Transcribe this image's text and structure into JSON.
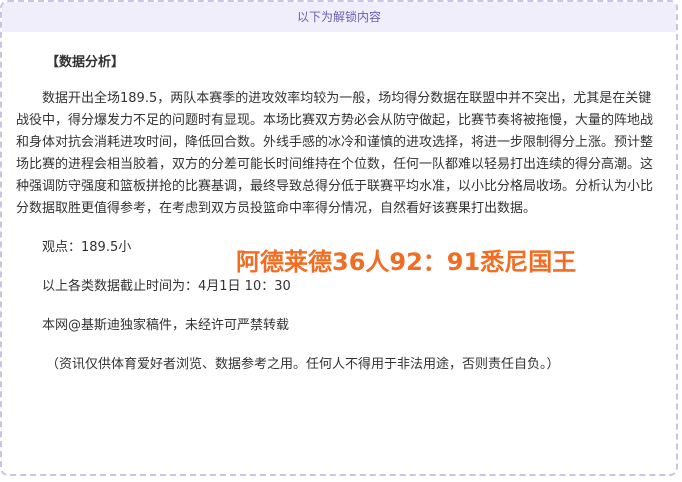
{
  "unlock_header": "以下为解锁内容",
  "section_title": "【数据分析】",
  "body_paragraph": "数据开出全场189.5，两队本赛季的进攻效率均较为一般，场均得分数据在联盟中并不突出，尤其是在关键战役中，得分爆发力不足的问题时有显现。本场比赛双方势必会从防守做起，比赛节奏将被拖慢，大量的阵地战和身体对抗会消耗进攻时间，降低回合数。外线手感的冰冷和谨慎的进攻选择，将进一步限制得分上涨。预计整场比赛的进程会相当胶着，双方的分差可能长时间维持在个位数，任何一队都难以轻易打出连续的得分高潮。这种强调防守强度和篮板拼抢的比赛基调，最终导致总得分低于联赛平均水准，以小比分格局收场。分析认为小比分数据取胜更值得参考，在考虑到双方员投篮命中率得分情况，自然看好该赛果打出数据。",
  "views_line": "观点：189.5小",
  "cutoff_line": "以上各类数据截止时间为：4月1日 10：30",
  "copyright_line": "本网@基斯迪独家稿件，未经许可严禁转载",
  "disclaimer_line": "（资讯仅供体育爱好者浏览、数据参考之用。任何人不得用于非法用途，否则责任自负。）",
  "score_overlay": "阿德莱德36人92：91悉尼国王",
  "colors": {
    "header_bg": "#f0eefb",
    "header_text": "#6b5fb5",
    "border": "#c9c3e6",
    "score": "#f26d21",
    "body_text": "#333333"
  }
}
